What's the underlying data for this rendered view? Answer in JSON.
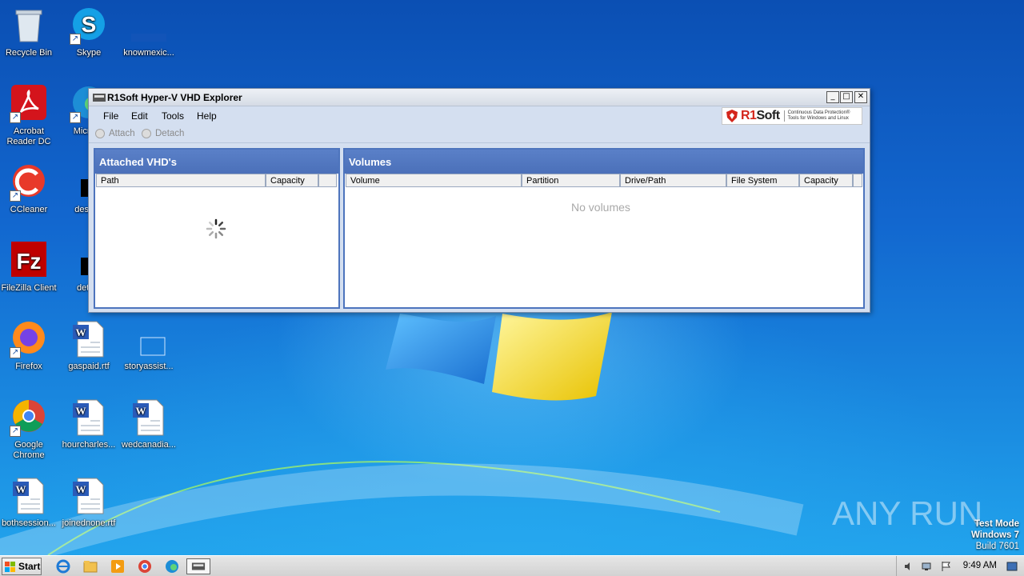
{
  "desktop": {
    "icons": [
      {
        "name": "recycle-bin",
        "label": "Recycle Bin"
      },
      {
        "name": "skype",
        "label": "Skype"
      },
      {
        "name": "knowmexic",
        "label": "knowmexic..."
      },
      {
        "name": "acrobat",
        "label": "Acrobat Reader DC"
      },
      {
        "name": "microsoft-edge",
        "label": "Microso"
      },
      {
        "name": "ccleaner",
        "label": "CCleaner"
      },
      {
        "name": "describ",
        "label": "describ"
      },
      {
        "name": "filezilla",
        "label": "FileZilla Client"
      },
      {
        "name": "detailr",
        "label": "detailr"
      },
      {
        "name": "firefox",
        "label": "Firefox"
      },
      {
        "name": "gaspaid",
        "label": "gaspaid.rtf"
      },
      {
        "name": "storyassist",
        "label": "storyassist..."
      },
      {
        "name": "chrome",
        "label": "Google Chrome"
      },
      {
        "name": "hourcharles",
        "label": "hourcharles..."
      },
      {
        "name": "wedcanadia",
        "label": "wedcanadia..."
      },
      {
        "name": "bothsession",
        "label": "bothsession..."
      },
      {
        "name": "joinednone",
        "label": "joinednone.rtf"
      }
    ]
  },
  "window": {
    "title": "R1Soft Hyper-V VHD Explorer",
    "controls": {
      "minimize": "_",
      "maximize": "□",
      "close": "✕"
    },
    "menu": [
      "File",
      "Edit",
      "Tools",
      "Help"
    ],
    "brand": {
      "logo_prefix": "R1",
      "logo_suffix": "Soft",
      "tagline_1": "Continuous Data Protection®",
      "tagline_2": "Tools for Windows and Linux"
    },
    "toolbar": {
      "attach": "Attach",
      "detach": "Detach"
    },
    "attached_panel": {
      "title": "Attached VHD's",
      "columns": [
        "Path",
        "Capacity"
      ],
      "loading": true
    },
    "volumes_panel": {
      "title": "Volumes",
      "columns": [
        "Volume",
        "Partition",
        "Drive/Path",
        "File System",
        "Capacity"
      ],
      "empty_message": "No volumes"
    }
  },
  "watermark": {
    "text": "ANY RUN"
  },
  "system_info": {
    "line1": "Test Mode",
    "line2": "Windows 7",
    "line3": "Build 7601"
  },
  "taskbar": {
    "start_label": "Start",
    "pinned": [
      "internet-explorer",
      "file-explorer",
      "media-player",
      "chrome",
      "edge",
      "vhd-explorer"
    ],
    "clock": "9:49 AM"
  },
  "colors": {
    "panel_header": "#4d74bd",
    "brand_red": "#d4261c",
    "window_bg": "#d4dff0"
  }
}
